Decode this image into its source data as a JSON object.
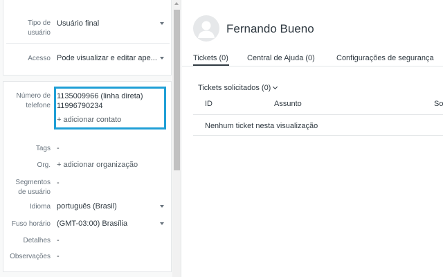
{
  "user_fields": {
    "user_type": {
      "label_line1": "Tipo de",
      "label_line2": "usuário",
      "value": "Usuário final"
    },
    "access": {
      "label": "Acesso",
      "value": "Pode visualizar e editar ape..."
    }
  },
  "contact": {
    "label_line1": "Número de",
    "label_line2": "telefone",
    "phone_primary": "1135009966 (linha direta)",
    "phone_secondary": "11996790234",
    "add_contact": "+ adicionar contato"
  },
  "details": {
    "tags": {
      "label": "Tags",
      "value": "-"
    },
    "org": {
      "label": "Org.",
      "value": "+ adicionar organização"
    },
    "segments": {
      "label_line1": "Segmentos",
      "label_line2": "de usuário",
      "value": "-"
    },
    "language": {
      "label": "Idioma",
      "value": "português (Brasil)"
    },
    "timezone": {
      "label": "Fuso horário",
      "value": "(GMT-03:00) Brasília"
    },
    "details_field": {
      "label": "Detalhes",
      "value": "-"
    },
    "notes": {
      "label": "Observações",
      "value": "-"
    }
  },
  "profile": {
    "name": "Fernando Bueno",
    "avatar_icon": "user-avatar-icon"
  },
  "tabs": [
    {
      "label": "Tickets (0)",
      "active": true
    },
    {
      "label": "Central de Ajuda (0)",
      "active": false
    },
    {
      "label": "Configurações de segurança",
      "active": false
    }
  ],
  "tickets": {
    "filter_label": "Tickets solicitados (0)",
    "columns": [
      "ID",
      "Assunto",
      "So"
    ],
    "empty_message": "Nenhum ticket nesta visualização"
  },
  "colors": {
    "highlight": "#1f9fd6",
    "active_tab": "#2f3941"
  }
}
